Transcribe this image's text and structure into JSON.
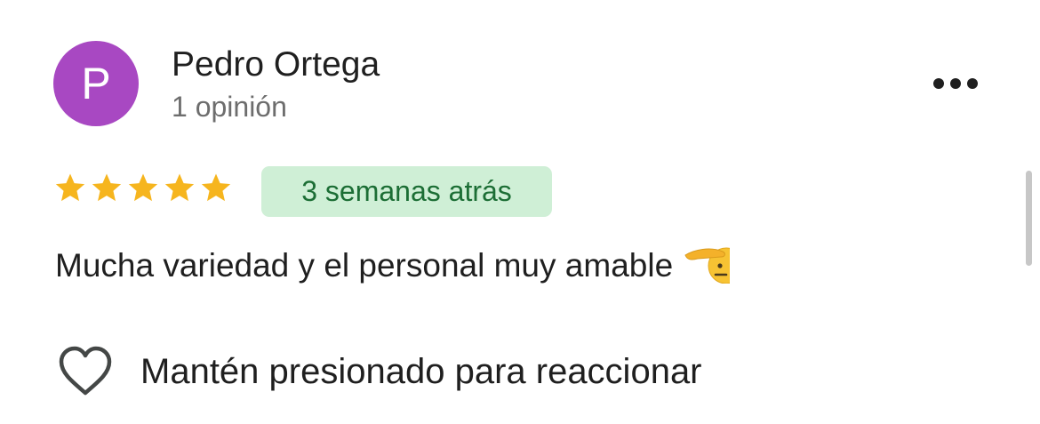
{
  "review": {
    "author": {
      "initial": "P",
      "name": "Pedro Ortega",
      "review_count": "1 opinión",
      "avatar_color": "#a848c2"
    },
    "more_icon": "more-horizontal-icon",
    "rating": {
      "value": 5,
      "max": 5,
      "star_icon": "star-icon",
      "star_color": "#f6b51e"
    },
    "time_badge": "3 semanas atrás",
    "text": "Mucha variedad y el personal muy amable",
    "emoji_icon": "saluting-face-icon",
    "react": {
      "icon": "heart-outline-icon",
      "label": "Mantén presionado para reaccionar"
    }
  },
  "colors": {
    "badge_background": "#cfefd6",
    "badge_text": "#1c6e35"
  }
}
